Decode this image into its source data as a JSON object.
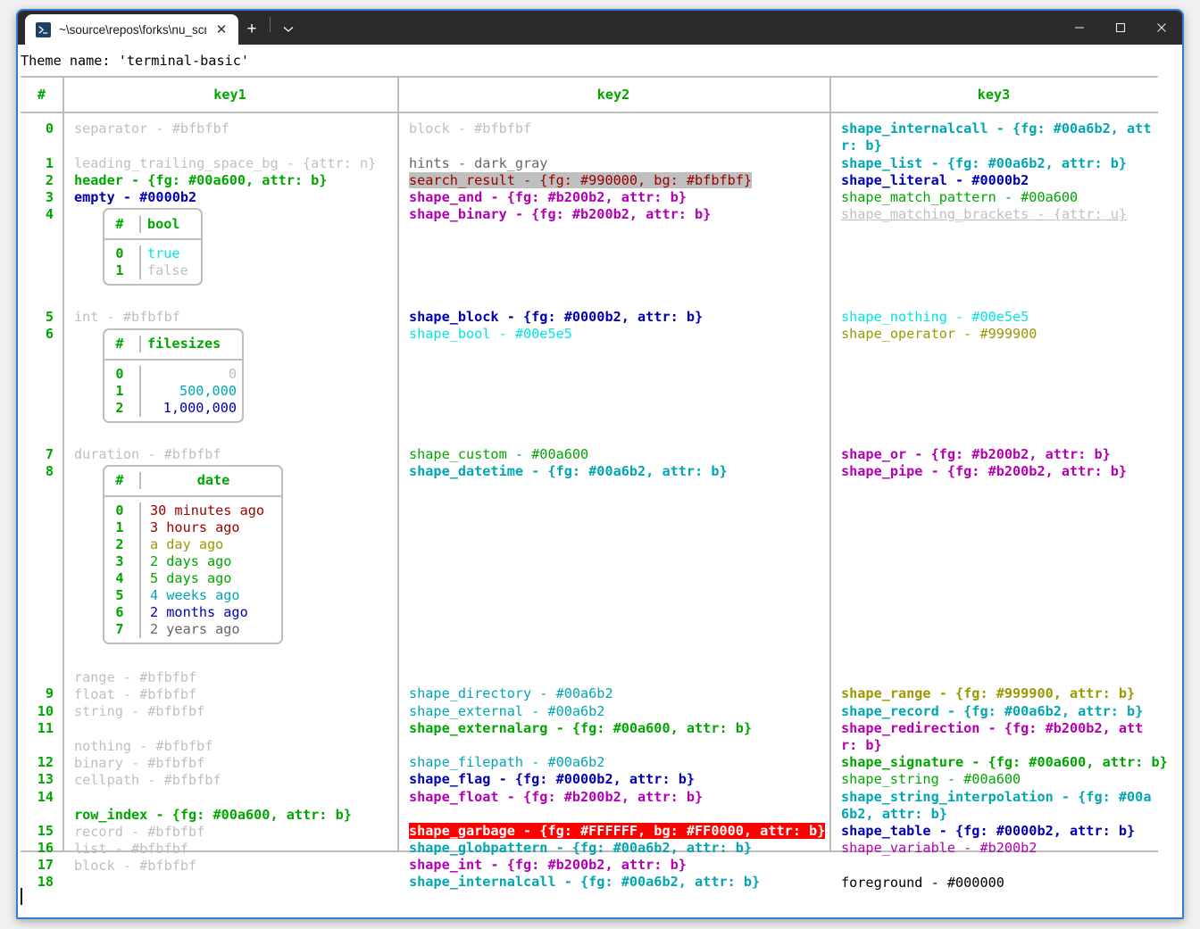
{
  "window": {
    "tab": {
      "title": "~\\source\\repos\\forks\\nu_scrip",
      "icon": "powershell-icon",
      "close_label": "✕"
    },
    "new_tab_label": "+",
    "dropdown_label": "⌄",
    "controls": {
      "minimize": "—",
      "maximize": "☐",
      "close": "✕"
    },
    "accent_color": "#2a7fd4",
    "titlebar_color": "#2b2b2b"
  },
  "terminal": {
    "theme_line": "Theme name: 'terminal-basic'",
    "table": {
      "headers": [
        "#",
        "key1",
        "key2",
        "key3"
      ],
      "index_column": [
        "0",
        "1",
        "2",
        "3",
        "4",
        "5",
        "6",
        "7",
        "8",
        "9",
        "10",
        "11",
        "12",
        "13",
        "14",
        "15",
        "16",
        "17",
        "18"
      ],
      "key1_lines": [
        "separator - #bfbfbf",
        "",
        "leading_trailing_space_bg - {attr: n}",
        "header - {fg: #00a600, attr: b}",
        "empty - #0000b2",
        "int - #bfbfbf",
        "duration - #bfbfbf",
        "range - #bfbfbf",
        "float - #bfbfbf",
        "string - #bfbfbf",
        "nothing - #bfbfbf",
        "binary - #bfbfbf",
        "cellpath - #bfbfbf",
        "row_index - {fg: #00a600, attr: b}",
        "record - #bfbfbf",
        "list - #bfbfbf",
        "block - #bfbfbf"
      ],
      "key2_lines": [
        "block - #bfbfbf",
        "hints - dark_gray",
        "search_result - {fg: #990000, bg: #bfbfbf}",
        "shape_and - {fg: #b200b2, attr: b}",
        "shape_binary - {fg: #b200b2, attr: b}",
        "shape_block - {fg: #0000b2, attr: b}",
        "shape_bool - #00e5e5",
        "shape_custom - #00a600",
        "shape_datetime - {fg: #00a6b2, attr: b}",
        "shape_directory - #00a6b2",
        "shape_external - #00a6b2",
        "shape_externalarg - {fg: #00a600, attr: b}",
        "shape_filepath - #00a6b2",
        "shape_flag - {fg: #0000b2, attr: b}",
        "shape_float - {fg: #b200b2, attr: b}",
        "shape_garbage - {fg: #FFFFFF, bg: #FF0000, attr: b}",
        "shape_globpattern - {fg: #00a6b2, attr: b}",
        "shape_int - {fg: #b200b2, attr: b}",
        "shape_internalcall - {fg: #00a6b2, attr: b}"
      ],
      "key3_lines": [
        "shape_internalcall - {fg: #00a6b2, attr: b}",
        "shape_list - {fg: #00a6b2, attr: b}",
        "shape_literal - #0000b2",
        "shape_match_pattern - #00a600",
        "shape_matching_brackets - {attr: u}",
        "shape_nothing - #00e5e5",
        "shape_operator - #999900",
        "shape_or - {fg: #b200b2, attr: b}",
        "shape_pipe - {fg: #b200b2, attr: b}",
        "shape_range - {fg: #999900, attr: b}",
        "shape_record - {fg: #00a6b2, attr: b}",
        "shape_redirection - {fg: #b200b2, attr: b}",
        "shape_signature - {fg: #00a600, attr: b}",
        "shape_string - #00a600",
        "shape_string_interpolation - {fg: #00a6b2, attr: b}",
        "shape_table - {fg: #0000b2, attr: b}",
        "shape_variable - #b200b2",
        "foreground - #000000"
      ]
    },
    "inner_tables": {
      "bool": {
        "headers": [
          "#",
          "bool"
        ],
        "rows": [
          [
            "0",
            "true"
          ],
          [
            "1",
            "false"
          ]
        ]
      },
      "filesizes": {
        "headers": [
          "#",
          "filesizes"
        ],
        "rows": [
          [
            "0",
            "0"
          ],
          [
            "1",
            "500,000"
          ],
          [
            "2",
            "1,000,000"
          ]
        ]
      },
      "date": {
        "headers": [
          "#",
          "date"
        ],
        "rows": [
          [
            "0",
            "30 minutes ago"
          ],
          [
            "1",
            "3 hours ago"
          ],
          [
            "2",
            "a day ago"
          ],
          [
            "3",
            "2 days ago"
          ],
          [
            "4",
            "5 days ago"
          ],
          [
            "5",
            "4 weeks ago"
          ],
          [
            "6",
            "2 months ago"
          ],
          [
            "7",
            "2 years ago"
          ]
        ]
      }
    },
    "cursor": "|"
  }
}
